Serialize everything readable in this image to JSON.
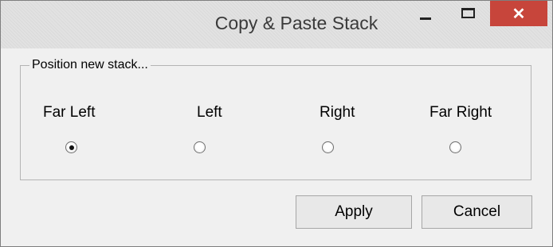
{
  "window": {
    "title": "Copy & Paste Stack",
    "close_glyph": "✕"
  },
  "group": {
    "label": "Position new stack..."
  },
  "options": [
    {
      "label": "Far Left",
      "checked": true
    },
    {
      "label": "Left",
      "checked": false
    },
    {
      "label": "Right",
      "checked": false
    },
    {
      "label": "Far Right",
      "checked": false
    }
  ],
  "buttons": {
    "apply": "Apply",
    "cancel": "Cancel"
  },
  "colors": {
    "close_button": "#c7453b",
    "titlebar": "#e2e2e2",
    "window_bg": "#f0f0f0"
  }
}
